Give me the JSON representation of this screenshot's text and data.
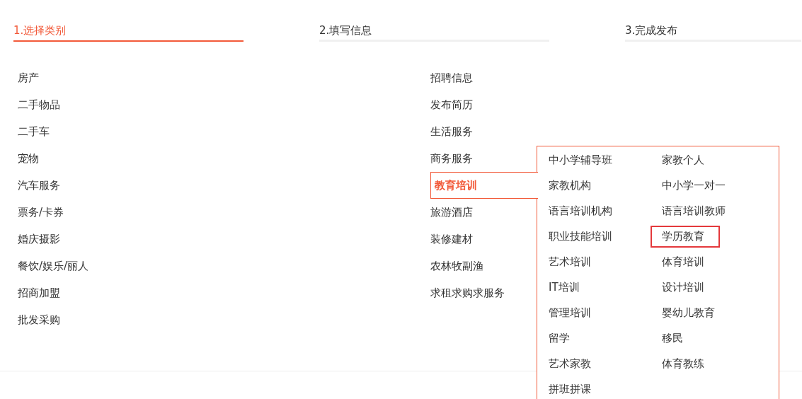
{
  "steps": [
    {
      "label": "1.选择类别",
      "selected": true
    },
    {
      "label": "2.填写信息",
      "selected": false
    },
    {
      "label": "3.完成发布",
      "selected": false
    }
  ],
  "category_columns": [
    [
      {
        "label": "房产",
        "selected": false
      },
      {
        "label": "二手物品",
        "selected": false
      },
      {
        "label": "二手车",
        "selected": false
      },
      {
        "label": "宠物",
        "selected": false
      },
      {
        "label": "汽车服务",
        "selected": false
      },
      {
        "label": "票务/卡券",
        "selected": false
      },
      {
        "label": "婚庆摄影",
        "selected": false
      },
      {
        "label": "餐饮/娱乐/丽人",
        "selected": false
      },
      {
        "label": "招商加盟",
        "selected": false
      },
      {
        "label": "批发采购",
        "selected": false
      }
    ],
    [
      {
        "label": "招聘信息",
        "selected": false
      },
      {
        "label": "发布简历",
        "selected": false
      },
      {
        "label": "生活服务",
        "selected": false
      },
      {
        "label": "商务服务",
        "selected": false
      },
      {
        "label": "教育培训",
        "selected": true
      },
      {
        "label": "旅游酒店",
        "selected": false
      },
      {
        "label": "装修建材",
        "selected": false
      },
      {
        "label": "农林牧副渔",
        "selected": false
      },
      {
        "label": "求租求购求服务",
        "selected": false
      }
    ]
  ],
  "subcategories": [
    {
      "label": "中小学辅导班",
      "selected": false
    },
    {
      "label": "家教个人",
      "selected": false
    },
    {
      "label": "家教机构",
      "selected": false
    },
    {
      "label": "中小学一对一",
      "selected": false
    },
    {
      "label": "语言培训机构",
      "selected": false
    },
    {
      "label": "语言培训教师",
      "selected": false
    },
    {
      "label": "职业技能培训",
      "selected": false
    },
    {
      "label": "学历教育",
      "selected": true
    },
    {
      "label": "艺术培训",
      "selected": false
    },
    {
      "label": "体育培训",
      "selected": false
    },
    {
      "label": "IT培训",
      "selected": false
    },
    {
      "label": "设计培训",
      "selected": false
    },
    {
      "label": "管理培训",
      "selected": false
    },
    {
      "label": "婴幼儿教育",
      "selected": false
    },
    {
      "label": "留学",
      "selected": false
    },
    {
      "label": "移民",
      "selected": false
    },
    {
      "label": "艺术家教",
      "selected": false
    },
    {
      "label": "体育教练",
      "selected": false
    },
    {
      "label": "拼班拼课",
      "selected": false
    }
  ]
}
